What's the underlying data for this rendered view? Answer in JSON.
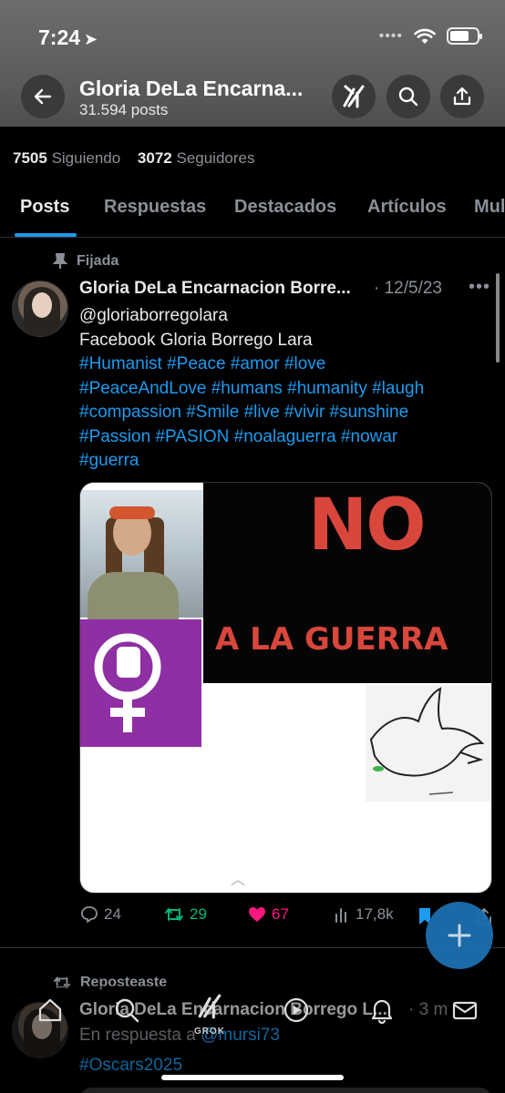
{
  "status_bar": {
    "time": "7:24",
    "signal": "••••"
  },
  "header": {
    "title": "Gloria DeLa Encarna...",
    "subtitle": "31.594 posts"
  },
  "profile": {
    "following_count": "7505",
    "following_label": "Siguiendo",
    "followers_count": "3072",
    "followers_label": "Seguidores"
  },
  "tabs": [
    "Posts",
    "Respuestas",
    "Destacados",
    "Artículos",
    "Mul"
  ],
  "pinned_post": {
    "pinned_label": "Fijada",
    "author": "Gloria DeLa Encarnacion Borre...",
    "date": "· 12/5/23",
    "more": "•••",
    "lines": [
      "@gloriaborregolara",
      "Facebook Gloria Borrego Lara"
    ],
    "hashtags": [
      "#Humanist #Peace #amor #love",
      "#PeaceAndLove #humans #humanity #laugh",
      "#compassion #Smile #live #vivir #sunshine",
      "#Passion #PASION #noalaguerra #nowar",
      "#guerra"
    ],
    "media_text": {
      "no": "NO",
      "a_la_guerra": "A LA GUERRA",
      "expand": "︿"
    },
    "stats": {
      "replies": "24",
      "reposts": "29",
      "likes": "67",
      "views": "17,8k"
    }
  },
  "second_post": {
    "repost_label": "Reposteaste",
    "author": "Gloria DeLa Encarnacion Borrego L...",
    "date": "· 3 m",
    "reply_prefix": "En respuesta a ",
    "reply_handle": "@mursi73",
    "tag": "#Oscars2025"
  },
  "bottom_nav": {
    "grok_label": "GROK"
  },
  "colors": {
    "accent": "#1d9bf0",
    "like": "#f91880",
    "repost": "#00ba7c"
  }
}
